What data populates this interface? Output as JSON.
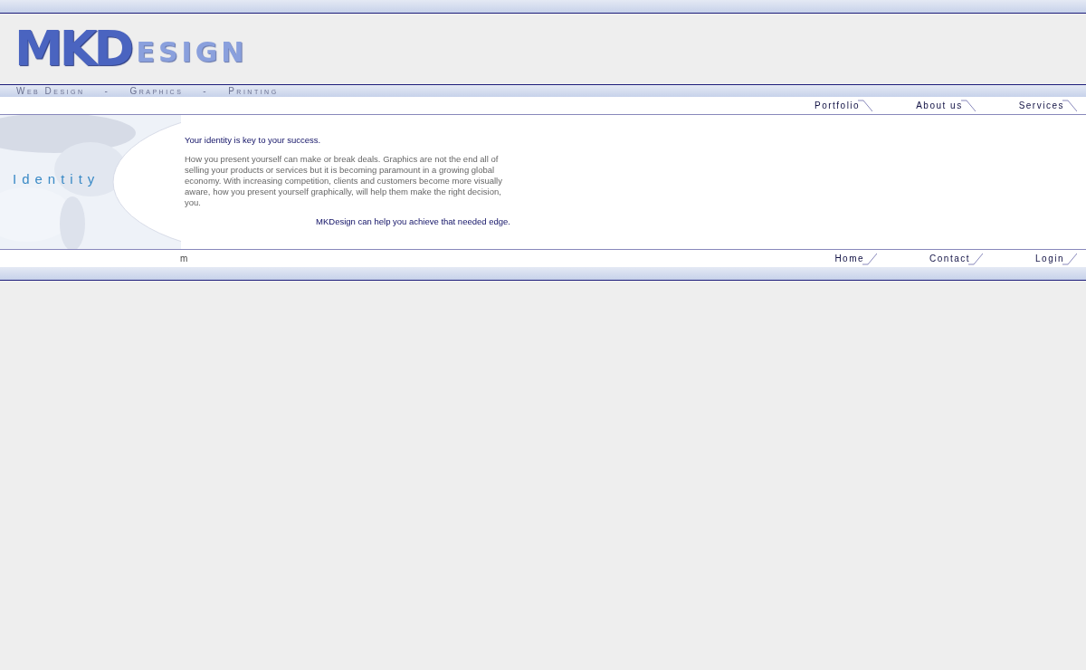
{
  "logo": {
    "initials": "MKD",
    "rest": "ESIGN"
  },
  "tagline": [
    "Web Design",
    "-",
    "Graphics",
    "-",
    "Printing"
  ],
  "top_nav": [
    "Portfolio",
    "About us",
    "Services"
  ],
  "section_title": "Identity",
  "content": {
    "heading": "Your identity is key to your success.",
    "body": "How you present yourself can make or break deals. Graphics are not the end all of selling your products or services but it is becoming paramount in a growing global economy. With increasing competition, clients and customers become more visually aware, how you present yourself graphically, will help them make the right decision, you.",
    "closing": "MKDesign can help you achieve that needed edge."
  },
  "footer_text": "m",
  "bottom_nav": [
    "Home",
    "Contact",
    "Login"
  ]
}
